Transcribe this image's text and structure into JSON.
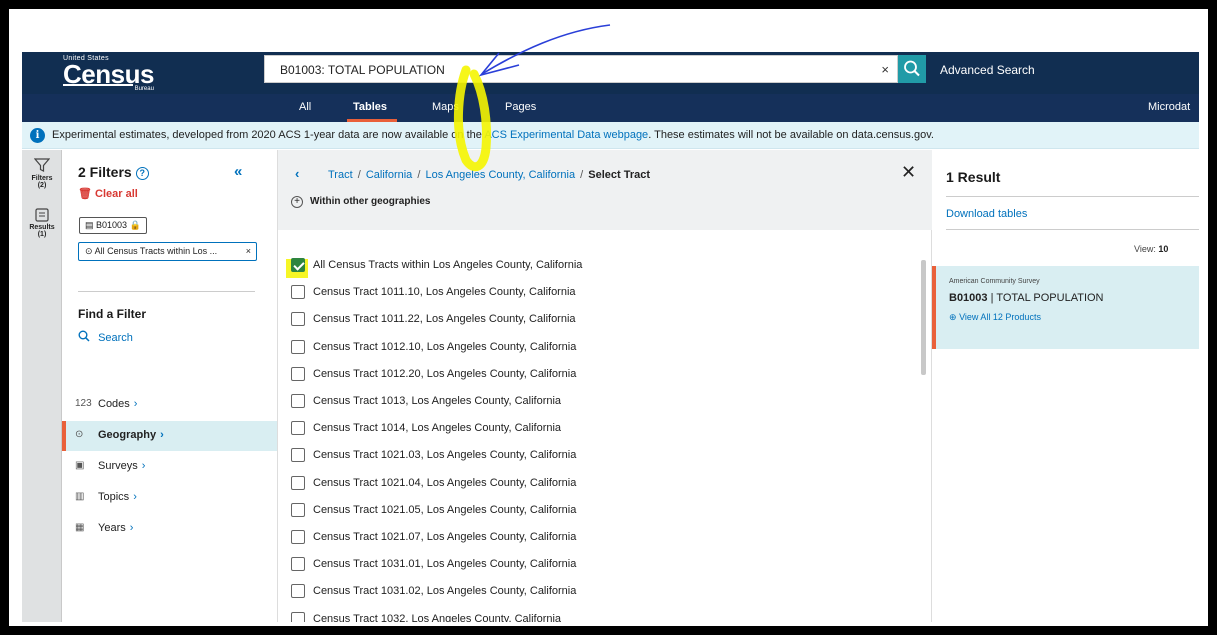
{
  "header": {
    "logo_top": "United States",
    "logo_name": "Census",
    "logo_bureau": "Bureau",
    "search_value": "B01003: TOTAL POPULATION",
    "search_clear": "×",
    "advanced_search": "Advanced Search"
  },
  "nav": {
    "all": "All",
    "tables": "Tables",
    "maps": "Maps",
    "pages": "Pages",
    "microdata": "Microdat"
  },
  "banner": {
    "text_before": "Experimental estimates, developed from 2020 ACS 1-year data are now available on the ",
    "link": "ACS Experimental Data webpage",
    "text_after": ". These estimates will not be available on data.census.gov."
  },
  "rail": {
    "filters_label": "Filters",
    "filters_count": "(2)",
    "results_label": "Results",
    "results_count": "(1)"
  },
  "filters": {
    "title": "2 Filters",
    "clear_all": "Clear all",
    "chip_table": "B01003",
    "chip_geo": "All Census Tracts within Los ...",
    "find_title": "Find a Filter",
    "search": "Search",
    "items": [
      {
        "label": "Codes",
        "icon": "123"
      },
      {
        "label": "Geography",
        "icon": "map-pin-icon"
      },
      {
        "label": "Surveys",
        "icon": "clipboard-icon"
      },
      {
        "label": "Topics",
        "icon": "book-icon"
      },
      {
        "label": "Years",
        "icon": "calendar-icon"
      }
    ]
  },
  "tract": {
    "crumb_1": "Tract",
    "crumb_2": "California",
    "crumb_3": "Los Angeles County, California",
    "crumb_current": "Select Tract",
    "within": "Within other geographies",
    "rows": [
      {
        "label": "All Census Tracts within Los Angeles County, California",
        "checked": true
      },
      {
        "label": "Census Tract 1011.10, Los Angeles County, California",
        "checked": false
      },
      {
        "label": "Census Tract 1011.22, Los Angeles County, California",
        "checked": false
      },
      {
        "label": "Census Tract 1012.10, Los Angeles County, California",
        "checked": false
      },
      {
        "label": "Census Tract 1012.20, Los Angeles County, California",
        "checked": false
      },
      {
        "label": "Census Tract 1013, Los Angeles County, California",
        "checked": false
      },
      {
        "label": "Census Tract 1014, Los Angeles County, California",
        "checked": false
      },
      {
        "label": "Census Tract 1021.03, Los Angeles County, California",
        "checked": false
      },
      {
        "label": "Census Tract 1021.04, Los Angeles County, California",
        "checked": false
      },
      {
        "label": "Census Tract 1021.05, Los Angeles County, California",
        "checked": false
      },
      {
        "label": "Census Tract 1021.07, Los Angeles County, California",
        "checked": false
      },
      {
        "label": "Census Tract 1031.01, Los Angeles County, California",
        "checked": false
      },
      {
        "label": "Census Tract 1031.02, Los Angeles County, California",
        "checked": false
      },
      {
        "label": "Census Tract 1032, Los Angeles County, California",
        "checked": false
      }
    ]
  },
  "results": {
    "title": "1 Result",
    "download": "Download tables",
    "view_label": "View:",
    "view_value": "10",
    "survey": "American Community Survey",
    "code": "B01003",
    "name": "TOTAL POPULATION",
    "products": "View All 12 Products"
  },
  "colors": {
    "header_bg": "#112e51",
    "accent_orange": "#e9603a",
    "link_blue": "#0071bc",
    "teal": "#219ba7",
    "highlight_yellow": "#f5f500",
    "annotation_blue": "#2a3fd8"
  }
}
